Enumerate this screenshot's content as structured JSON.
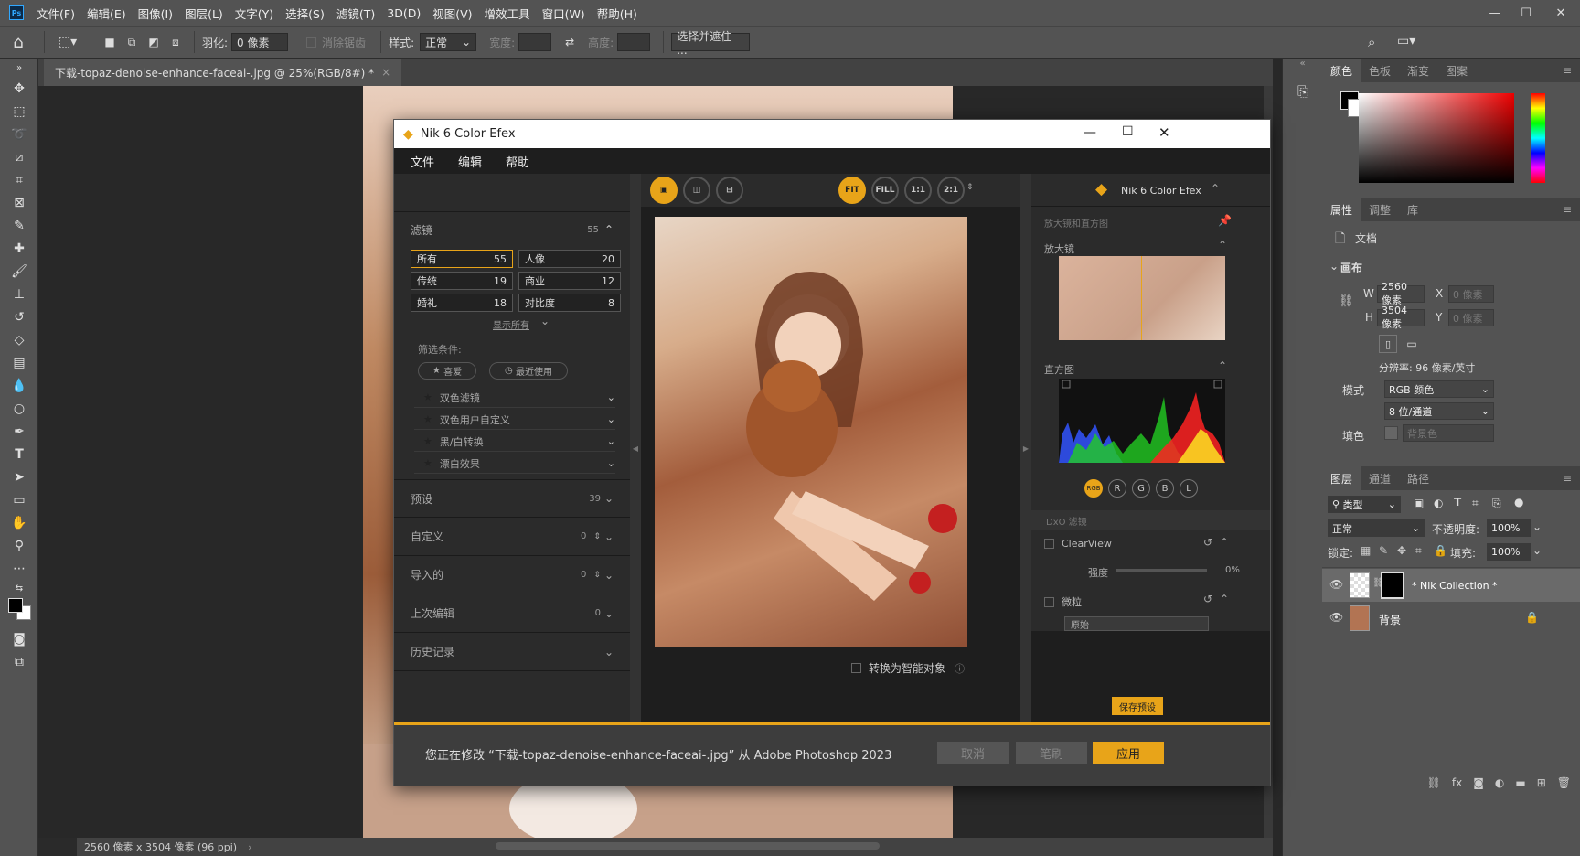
{
  "menubar": {
    "items": [
      "文件(F)",
      "编辑(E)",
      "图像(I)",
      "图层(L)",
      "文字(Y)",
      "选择(S)",
      "滤镜(T)",
      "3D(D)",
      "视图(V)",
      "增效工具",
      "窗口(W)",
      "帮助(H)"
    ],
    "logo": "Ps"
  },
  "options": {
    "feather_label": "羽化:",
    "feather_value": "0 像素",
    "antialias_label": "消除锯齿",
    "style_label": "样式:",
    "style_value": "正常",
    "width_label": "宽度:",
    "height_label": "高度:",
    "select_mask_label": "选择并遮住 ..."
  },
  "document": {
    "tab_title": "下载-topaz-denoise-enhance-faceai-.jpg @ 25%(RGB/8#) *",
    "status": "2560 像素 x 3504 像素 (96 ppi)"
  },
  "nik": {
    "title": "Nik 6 Color Efex",
    "menu": [
      "文件",
      "编辑",
      "帮助"
    ],
    "brand": "Nik 6 Color Efex",
    "filters_header": "滤镜",
    "filters_count": "55",
    "filter_buttons": [
      {
        "label": "所有",
        "count": "55"
      },
      {
        "label": "人像",
        "count": "20"
      },
      {
        "label": "传统",
        "count": "19"
      },
      {
        "label": "商业",
        "count": "12"
      },
      {
        "label": "婚礼",
        "count": "18"
      },
      {
        "label": "对比度",
        "count": "8"
      }
    ],
    "show_all": "显示所有",
    "filter_conditions": "筛选条件:",
    "favorite": "喜爱",
    "recent": "最近使用",
    "filter_list": [
      "双色滤镜",
      "双色用户自定义",
      "黑/白转换",
      "漂白效果"
    ],
    "sections": [
      {
        "label": "预设",
        "count": "39"
      },
      {
        "label": "自定义",
        "count": "0"
      },
      {
        "label": "导入的",
        "count": "0"
      },
      {
        "label": "上次编辑",
        "count": "0"
      },
      {
        "label": "历史记录",
        "count": ""
      }
    ],
    "zoom_buttons": [
      "FIT",
      "FILL",
      "1:1",
      "2:1"
    ],
    "smart_object_label": "转换为智能对象",
    "loupe_header": "放大镜和直方图",
    "loupe_label": "放大镜",
    "histogram_label": "直方图",
    "channels": [
      "RGB",
      "R",
      "G",
      "B",
      "L"
    ],
    "dxo_filter": "DxO 滤镜",
    "clearview": "ClearView",
    "strength_label": "强度",
    "strength_value": "0%",
    "grain_label": "微粒",
    "grain_select": "原始",
    "save_preset": "保存预设",
    "status_message": "您正在修改 “下载-topaz-denoise-enhance-faceai-.jpg” 从 Adobe Photoshop 2023",
    "cancel": "取消",
    "brush": "笔刷",
    "apply": "应用"
  },
  "panels": {
    "color_tabs": [
      "颜色",
      "色板",
      "渐变",
      "图案"
    ],
    "prop_tabs": [
      "属性",
      "调整",
      "库"
    ],
    "doc_label": "文档",
    "canvas_label": "画布",
    "w_label": "W",
    "w_value": "2560 像素",
    "h_label": "H",
    "h_value": "3504 像素",
    "x_label": "X",
    "x_value": "0 像素",
    "y_label": "Y",
    "y_value": "0 像素",
    "resolution": "分辨率: 96 像素/英寸",
    "mode_label": "模式",
    "mode_value": "RGB 颜色",
    "depth_value": "8 位/通道",
    "fill_label": "填色",
    "fill_value": "背景色",
    "layer_tabs": [
      "图层",
      "通道",
      "路径"
    ],
    "kind_label": "类型",
    "blend_mode": "正常",
    "opacity_label": "不透明度:",
    "opacity_value": "100%",
    "lock_label": "锁定:",
    "fill2_label": "填充:",
    "fill2_value": "100%",
    "layers": [
      "Nik Collection",
      "背景"
    ]
  },
  "colors": {
    "accent": "#e8a419",
    "ps_blue": "#31a8ff"
  }
}
